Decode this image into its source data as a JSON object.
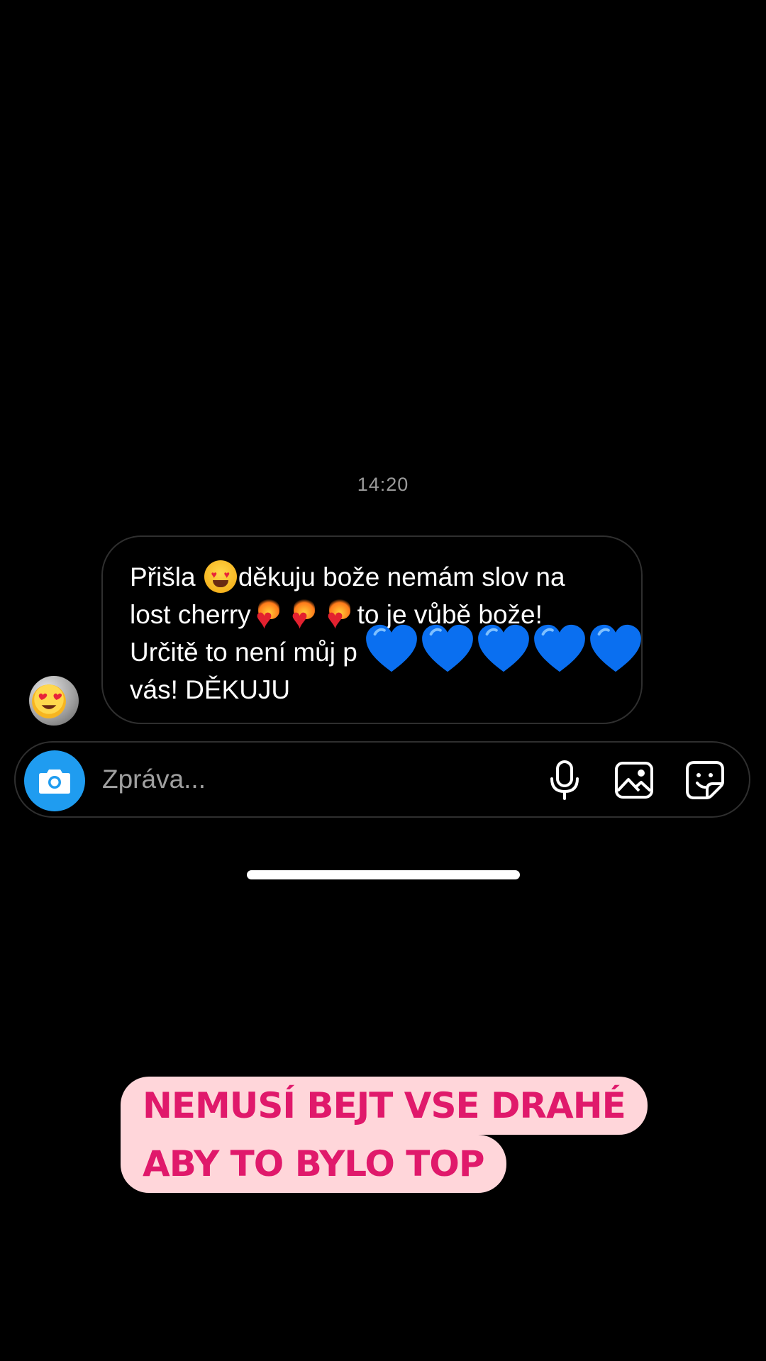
{
  "chat": {
    "timestamp": "14:20",
    "message": {
      "line1_a": "Přišla ",
      "line1_b": "děkuju bože nemám slov na",
      "line2_a": "lost cherry",
      "line2_b": "to je vůbě bože!",
      "line3": "Určitě to není můj p",
      "line4": "vás! DĚKUJU",
      "emoji_icons": [
        "heart-eyes-face",
        "heart-on-fire",
        "heart-on-fire",
        "heart-on-fire",
        "blue-heart",
        "blue-heart",
        "blue-heart",
        "blue-heart",
        "blue-heart"
      ]
    },
    "avatar_icon": "heart-eyes-face"
  },
  "composer": {
    "placeholder": "Zpráva...",
    "camera_color": "#1f9cf0",
    "icons": [
      "camera-icon",
      "microphone-icon",
      "gallery-icon",
      "sticker-icon"
    ]
  },
  "caption": {
    "line1": "NEMUSÍ BEJT VSE DRAHÉ",
    "line2": "ABY TO BYLO TOP",
    "text_color": "#e0196b",
    "background_color": "#ffd6da"
  }
}
